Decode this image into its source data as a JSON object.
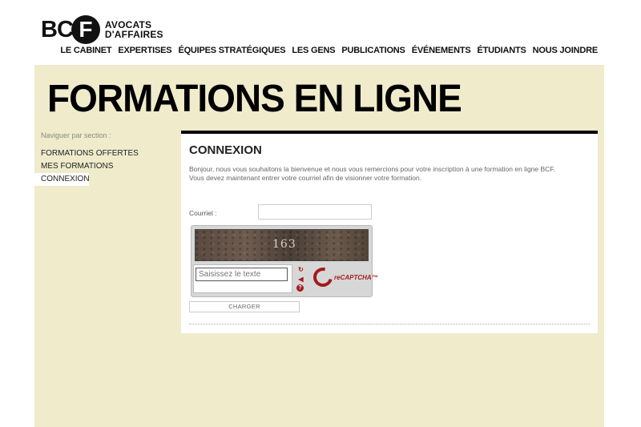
{
  "logo": {
    "bc": "BC",
    "f": "F",
    "line1": "AVOCATS",
    "line2": "D'AFFAIRES"
  },
  "nav": [
    "LE CABINET",
    "EXPERTISES",
    "ÉQUIPES STRATÉGIQUES",
    "LES GENS",
    "PUBLICATIONS",
    "ÉVÉNEMENTS",
    "ÉTUDIANTS",
    "NOUS JOINDRE"
  ],
  "page": {
    "title": "FORMATIONS EN LIGNE"
  },
  "sidebar": {
    "heading": "Naviguer par section :",
    "items": [
      {
        "label": "FORMATIONS OFFERTES",
        "active": false
      },
      {
        "label": "MES FORMATIONS",
        "active": false
      },
      {
        "label": "CONNEXION",
        "active": true
      }
    ]
  },
  "main": {
    "title": "CONNEXION",
    "intro_line1": "Bonjour, nous vous souhaitons la bienvenue et nous vous remercions pour votre inscription à une formation en ligne BCF.",
    "intro_line2": "Vous devez maintenant entrer votre courriel afin de visionner votre formation.",
    "courriel_label": "Courriel :",
    "courriel_value": "",
    "captcha": {
      "word": "163",
      "input_placeholder": "Saisissez le texte",
      "logo_text": "reCAPTCHA™",
      "colors": {
        "accent": "#a21b1b"
      }
    },
    "submit_label": "CHARGER"
  },
  "colors": {
    "panel_bg": "#efebcb",
    "content_border": "#000000"
  }
}
